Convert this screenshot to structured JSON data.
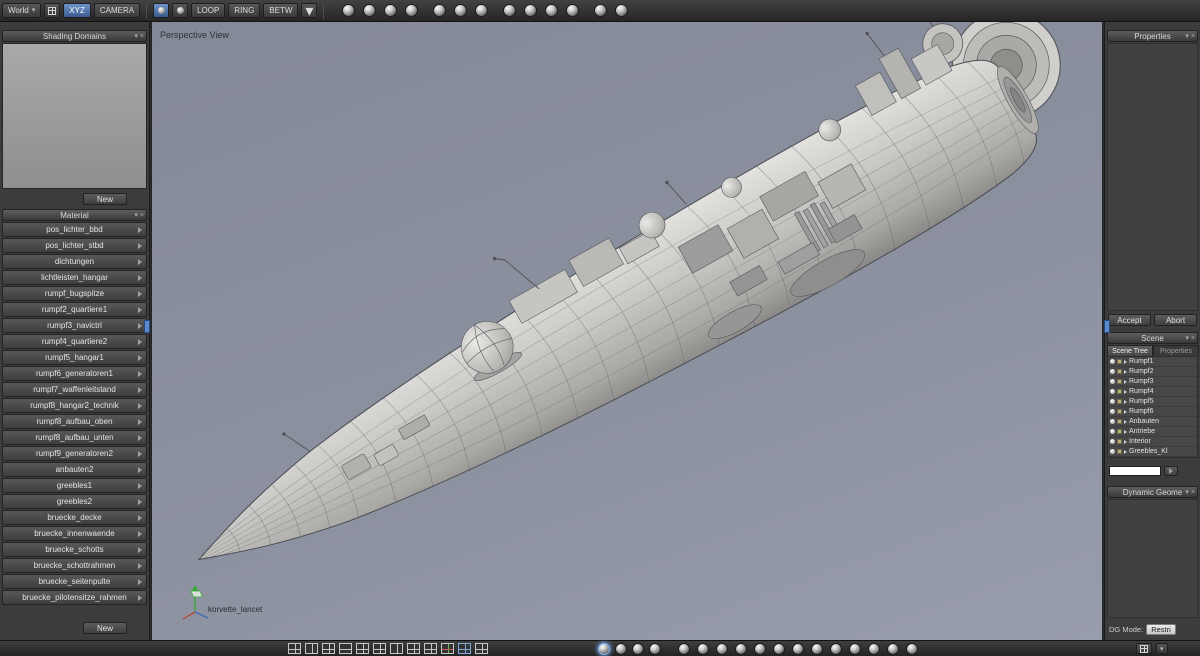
{
  "icons": {
    "chevron_down": "▾",
    "close": "×"
  },
  "colors": {
    "viewport_bg": "#8c91a0",
    "panel_bg": "#3c3c3c",
    "accent_blue": "#5b8ace"
  },
  "top_toolbar": {
    "world_button": "World",
    "xyz_button": "XYZ",
    "camera_button": "CAMERA",
    "loop_button": "LOOP",
    "ring_button": "RING",
    "betw_button": "BETW",
    "tool_spheres_a": [
      "plain",
      "plain",
      "plain",
      "plain"
    ],
    "tool_spheres_b": [
      "plain",
      "plain",
      "plain"
    ],
    "tool_spheres_c": [
      "plain",
      "plain",
      "plain",
      "plain"
    ],
    "tool_spheres_d": [
      "plain",
      "plain"
    ]
  },
  "left_panel": {
    "shading_domains": {
      "title": "Shading Domains",
      "new_button": "New"
    },
    "material": {
      "title": "Material",
      "new_button": "New",
      "items": [
        "pos_lichter_bbd",
        "pos_lichter_stbd",
        "dichtungen",
        "lichtleisten_hangar",
        "rumpf_bugspitze",
        "rumpf2_quartiere1",
        "rumpf3_navictrl",
        "rumpf4_quartiere2",
        "rumpf5_hangar1",
        "rumpf6_generatoren1",
        "rumpf7_waffenleitstand",
        "rumpf8_hangar2_technik",
        "rumpf8_aufbau_oben",
        "rumpf8_aufbau_unten",
        "rumpf9_generatoren2",
        "anbauten2",
        "greebles1",
        "greebles2",
        "bruecke_decke",
        "bruecke_innenwaende",
        "bruecke_schotts",
        "bruecke_schottrahmen",
        "bruecke_seitenpulte",
        "bruecke_pilotensitze_rahmen"
      ]
    }
  },
  "viewport": {
    "label": "Perspective View",
    "model_label": "korvette_lancet"
  },
  "right_panel": {
    "properties": {
      "title": "Properties"
    },
    "accept_button": "Accept",
    "abort_button": "Abort",
    "scene": {
      "title": "Scene",
      "tabs": [
        "Scene Tree",
        "Properties"
      ],
      "filter_value": "",
      "items": [
        "Rumpf1",
        "Rumpf2",
        "Rumpf3",
        "Rumpf4",
        "Rumpf5",
        "Rumpf6",
        "Anbauten",
        "Antriebe",
        "Interior",
        "Greebles_Kl"
      ]
    },
    "dynamic_geometry": {
      "title": "Dynamic Geome"
    },
    "dg_mode": {
      "label": "DG Mode:",
      "value": "Restri"
    }
  },
  "bottom_toolbar": {
    "layout_panes": [
      "quad",
      "vsplit",
      "quad",
      "hsplit",
      "quad",
      "quad",
      "vsplit",
      "quad",
      "quad",
      "rg",
      "blue",
      "quad"
    ],
    "mode_spheres": [
      "active",
      "plain",
      "plain",
      "plain"
    ],
    "tool_spheres": [
      "plain",
      "plain",
      "plain",
      "plain",
      "plain",
      "plain",
      "plain",
      "plain",
      "plain",
      "plain",
      "plain",
      "plain",
      "plain"
    ]
  }
}
